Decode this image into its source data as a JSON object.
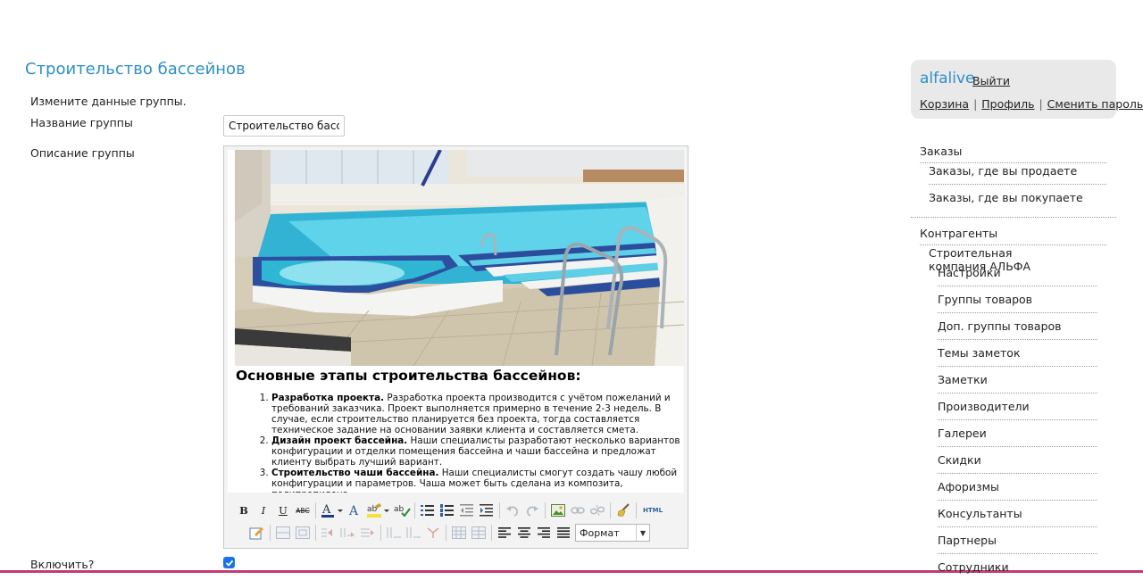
{
  "page": {
    "title": "Строительство бассейнов",
    "intro": "Измените данные группы.",
    "name_label": "Название группы",
    "name_value": "Строительство бассейнов",
    "description_label": "Описание группы",
    "enable_label": "Включить?"
  },
  "editor": {
    "heading": "Основные этапы строительства бассейнов:",
    "steps": [
      {
        "title": "Разработка проекта.",
        "text": " Разработка проекта производится с учётом пожеланий и требований заказчика. Проект выполняется примерно в течение 2-3 недель. В случае, если строительство планируется без проекта, тогда составляется техническое задание на основании заявки клиента и составляется смета."
      },
      {
        "title": "Дизайн проект бассейна.",
        "text": " Наши специалисты разработают несколько вариантов конфигурации и отделки помещения бассейна и чаши бассейна и предложат клиенту выбрать лучший вариант."
      },
      {
        "title": "Строительство чаши бассейна.",
        "text": " Наши специалисты смогут создать чашу любой конфигурации и параметров. Чаша может быть сделана из композита, полипропилена"
      }
    ],
    "toolbar": {
      "bold": "B",
      "italic": "I",
      "underline": "U",
      "strike": "ABC",
      "html": "HTML",
      "format_select": "Формат"
    }
  },
  "user": {
    "name": "alfalive",
    "logout": "Выйти",
    "links": [
      "Корзина",
      "Профиль",
      "Сменить пароль"
    ]
  },
  "nav": {
    "orders": "Заказы",
    "orders_sell": "Заказы, где вы продаете",
    "orders_buy": "Заказы, где вы покупаете",
    "contractors": "Контрагенты",
    "company": "Строительная компания АЛЬФА",
    "items": [
      "Настройки",
      "Группы товаров",
      "Доп. группы товаров",
      "Темы заметок",
      "Заметки",
      "Производители",
      "Галереи",
      "Скидки",
      "Афоризмы",
      "Консультанты",
      "Партнеры",
      "Сотрудники"
    ]
  },
  "colors": {
    "accent": "#2d8fc7",
    "checkbox": "#1a73e8",
    "bottom_bar": "#c43a74",
    "panel_bg": "#e9e9e9"
  }
}
